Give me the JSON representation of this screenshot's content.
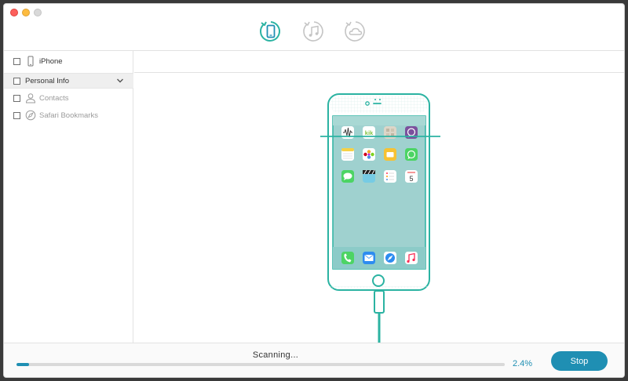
{
  "toolbar": {
    "modes": [
      {
        "name": "recover-from-ios-device",
        "icon": "phone-restore-icon",
        "active": true
      },
      {
        "name": "recover-from-itunes-backup",
        "icon": "music-restore-icon",
        "active": false
      },
      {
        "name": "recover-from-icloud-backup",
        "icon": "cloud-restore-icon",
        "active": false
      }
    ]
  },
  "sidebar": {
    "device": {
      "label": "iPhone",
      "icon": "iphone-icon"
    },
    "group": {
      "label": "Personal Info",
      "icon": "chevron-down-icon"
    },
    "items": [
      {
        "label": "Contacts",
        "icon": "person-icon"
      },
      {
        "label": "Safari Bookmarks",
        "icon": "compass-icon"
      }
    ]
  },
  "phone": {
    "apps": [
      "voice-memos-icon",
      "kik-icon",
      "app-grid-icon",
      "viber-icon",
      "notes-icon",
      "photos-icon",
      "folder-icon",
      "whatsapp-icon",
      "messages-icon",
      "clapperboard-icon",
      "reminders-icon",
      "calendar-icon"
    ],
    "calendar_day": "5",
    "kik_label": "kik",
    "dock": [
      "phone-call-icon",
      "mail-icon",
      "safari-icon",
      "music-icon"
    ]
  },
  "status": {
    "text": "Scanning...",
    "percent_text": "2.4%",
    "progress": 0.024,
    "stop_label": "Stop"
  },
  "colors": {
    "accent": "#1f8fb3",
    "teal": "#2bb3a2",
    "screen": "#9fd1cf"
  }
}
